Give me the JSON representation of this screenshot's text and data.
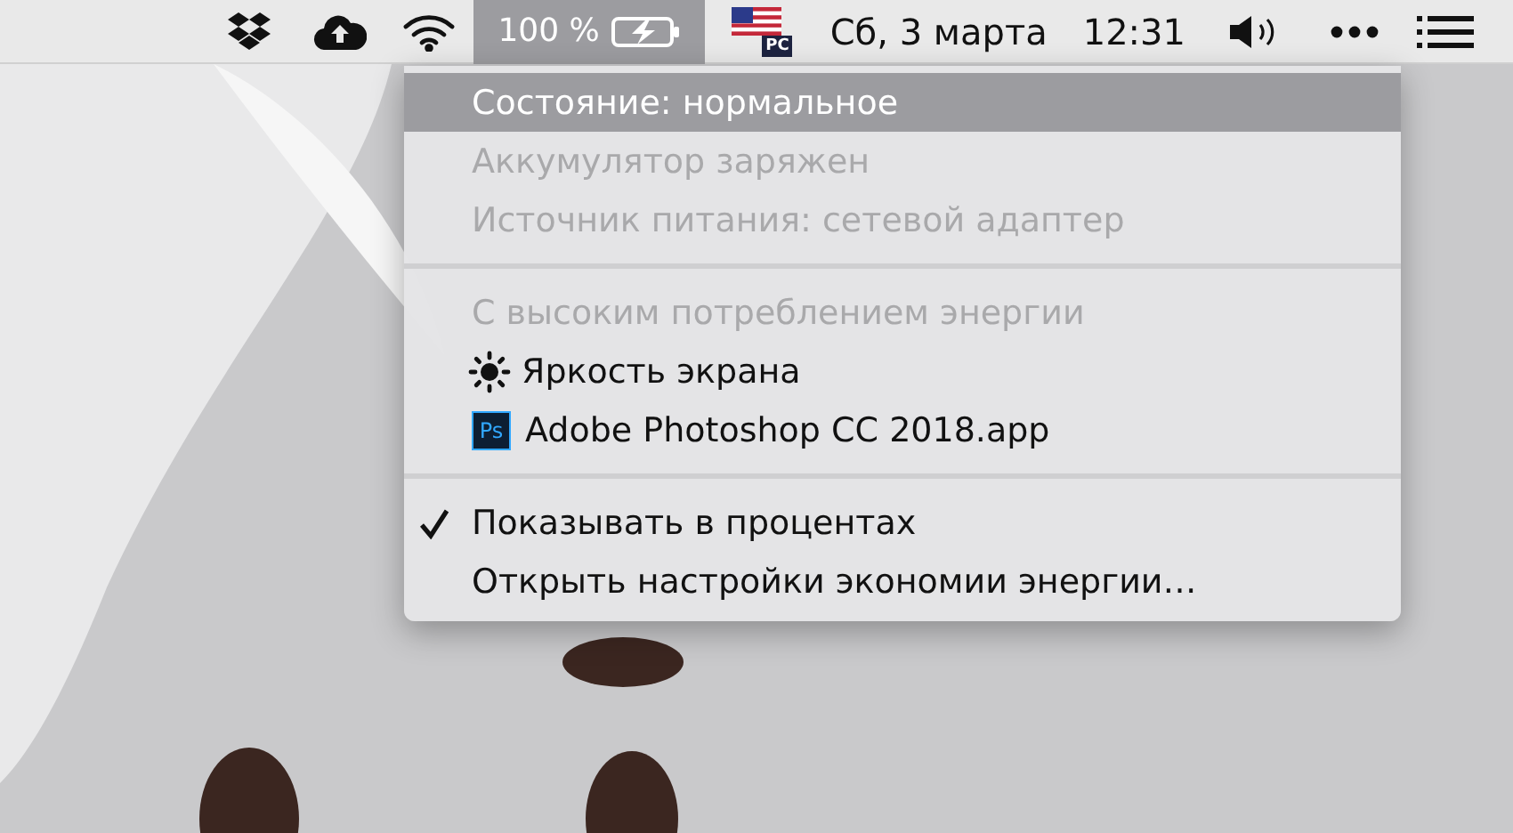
{
  "menu_bar": {
    "items": [
      {
        "kind": "dropbox",
        "selected": false
      },
      {
        "kind": "cloud",
        "selected": false
      },
      {
        "kind": "wifi",
        "selected": false
      },
      {
        "kind": "battery",
        "label": "100 %",
        "selected": true
      },
      {
        "kind": "flag",
        "label": "PC",
        "selected": false
      },
      {
        "kind": "text",
        "label": "Сб, 3 марта",
        "selected": false
      },
      {
        "kind": "text",
        "label": "12:31",
        "selected": false
      },
      {
        "kind": "volume",
        "selected": false
      },
      {
        "kind": "dots",
        "selected": false
      },
      {
        "kind": "list",
        "selected": false
      }
    ]
  },
  "battery_menu": {
    "sections": [
      {
        "items": [
          {
            "kind": "text",
            "label": "Состояние: нормальное",
            "disabled": false,
            "selected": true,
            "checked": false
          },
          {
            "kind": "text",
            "label": "Аккумулятор заряжен",
            "disabled": true,
            "selected": false,
            "checked": false
          },
          {
            "kind": "text",
            "label": "Источник питания: сетевой адаптер",
            "disabled": true,
            "selected": false,
            "checked": false
          }
        ]
      },
      {
        "items": [
          {
            "kind": "text",
            "label": "С высоким потреблением энергии",
            "disabled": true,
            "selected": false,
            "checked": false
          },
          {
            "kind": "brightness",
            "label": "Яркость экрана",
            "disabled": false,
            "selected": false,
            "checked": false
          },
          {
            "kind": "app",
            "label": "Adobe Photoshop CC 2018.app",
            "icon_text": "Ps",
            "disabled": false,
            "selected": false,
            "checked": false
          }
        ]
      },
      {
        "items": [
          {
            "kind": "text",
            "label": "Показывать в процентах",
            "disabled": false,
            "selected": false,
            "checked": true
          },
          {
            "kind": "text",
            "label": "Открыть настройки экономии энергии…",
            "disabled": false,
            "selected": false,
            "checked": false
          }
        ]
      }
    ]
  }
}
